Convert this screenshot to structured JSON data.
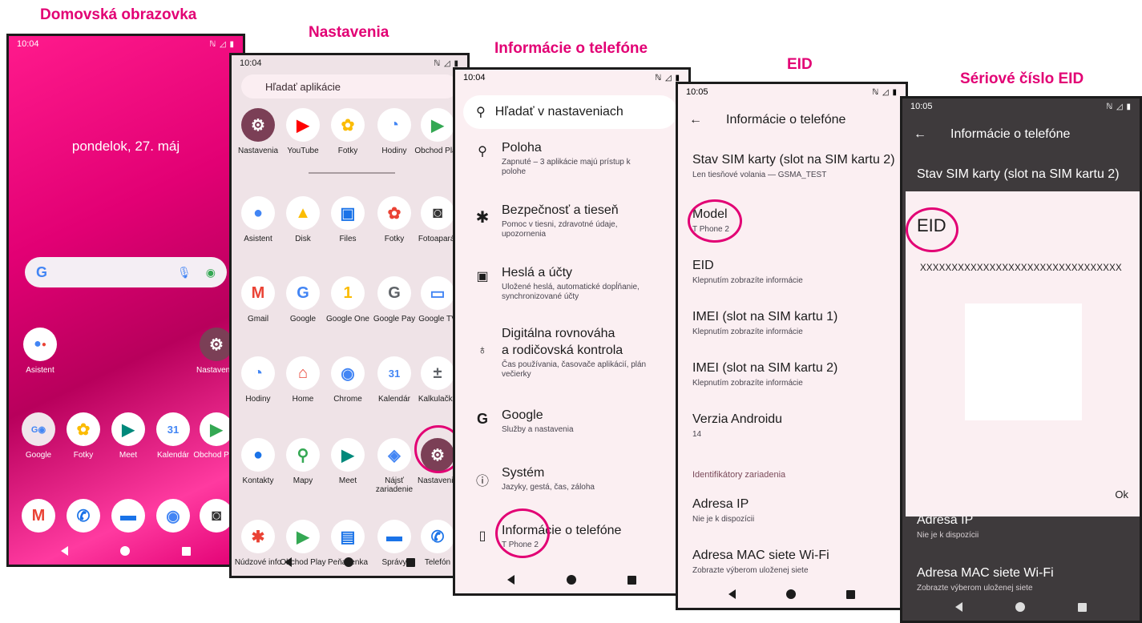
{
  "titles": {
    "home": "Domovská obrazovka",
    "settings": "Nastavenia",
    "about": "Informácie o telefóne",
    "eid": "EID",
    "serial": "Sériové číslo EID"
  },
  "colors": {
    "accent": "#e20074"
  },
  "home": {
    "time": "10:04",
    "status_icons": "ℕ ◿ ▮",
    "date": "pondelok, 27. máj",
    "search_logo": "G",
    "apps": [
      {
        "label": "Asistent",
        "icon": "assistant-icon"
      },
      {
        "label": "Nastavenia",
        "icon": "settings-icon"
      },
      {
        "label": "Google",
        "icon": "google-folder-icon"
      },
      {
        "label": "Fotky",
        "icon": "photos-icon"
      },
      {
        "label": "Meet",
        "icon": "meet-icon"
      },
      {
        "label": "Kalendár",
        "icon": "calendar-icon"
      },
      {
        "label": "Obchod Play",
        "icon": "play-store-icon"
      }
    ]
  },
  "drawer": {
    "time": "10:04",
    "status_icons": "ℕ ◿ ▮",
    "search_placeholder": "Hľadať aplikácie",
    "apps": [
      "Nastavenia",
      "YouTube",
      "Fotky",
      "Hodiny",
      "Obchod Play",
      "Asistent",
      "Disk",
      "Files",
      "Fotky",
      "Fotoaparát",
      "Gmail",
      "Google",
      "Google One",
      "Google Pay",
      "Google TV",
      "Hodiny",
      "Home",
      "Chrome",
      "Kalendár",
      "Kalkulačka",
      "Kontakty",
      "Mapy",
      "Meet",
      "Nájsť zariadenie",
      "Nastavenia",
      "Núdzové info",
      "Obchod Play",
      "Peňaženka",
      "Správy",
      "Telefón"
    ]
  },
  "about_phone": {
    "time": "10:04",
    "status_icons": "ℕ ◿ ▮",
    "search": "Hľadať v nastaveniach",
    "items": [
      {
        "title": "Poloha",
        "subtitle": "Zapnuté – 3 aplikácie majú prístup k polohe",
        "icon": "location-icon"
      },
      {
        "title": "Bezpečnosť a tieseň",
        "subtitle": "Pomoc v tiesni, zdravotné údaje, upozornenia",
        "icon": "emergency-icon"
      },
      {
        "title": "Heslá a účty",
        "subtitle": "Uložené heslá, automatické dopĺňanie, synchronizované účty",
        "icon": "accounts-icon"
      },
      {
        "title": "Digitálna rovnováha",
        "title2": "a rodičovská kontrola",
        "subtitle": "Čas používania, časovače aplikácií, plán večierky",
        "icon": "wellbeing-icon"
      },
      {
        "title": "Google",
        "subtitle": "Služby a nastavenia",
        "icon": "google-icon"
      },
      {
        "title": "Systém",
        "subtitle": "Jazyky, gestá, čas, záloha",
        "icon": "info-icon"
      },
      {
        "title": "Informácie o telefóne",
        "subtitle": "T Phone 2",
        "icon": "phone-icon"
      }
    ]
  },
  "eid_screen": {
    "time": "10:05",
    "status_icons": "ℕ ◿ ▮",
    "header": "Informácie o telefóne",
    "items": [
      {
        "title": "Stav SIM karty (slot na SIM kartu 2)",
        "subtitle": "Len tiesňové volania — GSMA_TEST"
      },
      {
        "title": "Model",
        "subtitle": "T Phone 2"
      },
      {
        "title": "EID",
        "subtitle": "Klepnutím zobrazíte informácie"
      },
      {
        "title": "IMEI (slot na SIM kartu 1)",
        "subtitle": "Klepnutím zobrazíte informácie"
      },
      {
        "title": "IMEI (slot na SIM kartu 2)",
        "subtitle": "Klepnutím zobrazíte informácie"
      },
      {
        "title": "Verzia Androidu",
        "subtitle": "14"
      }
    ],
    "section": "Identifikátory zariadenia",
    "items2": [
      {
        "title": "Adresa IP",
        "subtitle": "Nie je k dispozícii"
      },
      {
        "title": "Adresa MAC siete Wi-Fi",
        "subtitle": "Zobrazte výberom uloženej siete"
      }
    ]
  },
  "serial_screen": {
    "time": "10:05",
    "status_icons": "ℕ ◿ ▮",
    "header": "Informácie o telefóne",
    "bg_item": {
      "title": "Stav SIM karty (slot na SIM kartu 2)"
    },
    "dialog": {
      "title": "EID",
      "value": "XXXXXXXXXXXXXXXXXXXXXXXXXXXXXXXX",
      "ok": "Ok"
    },
    "items_below": [
      {
        "title": "Adresa IP",
        "subtitle": "Nie je k dispozícii"
      },
      {
        "title": "Adresa MAC siete Wi-Fi",
        "subtitle": "Zobrazte výberom uloženej siete"
      }
    ]
  }
}
